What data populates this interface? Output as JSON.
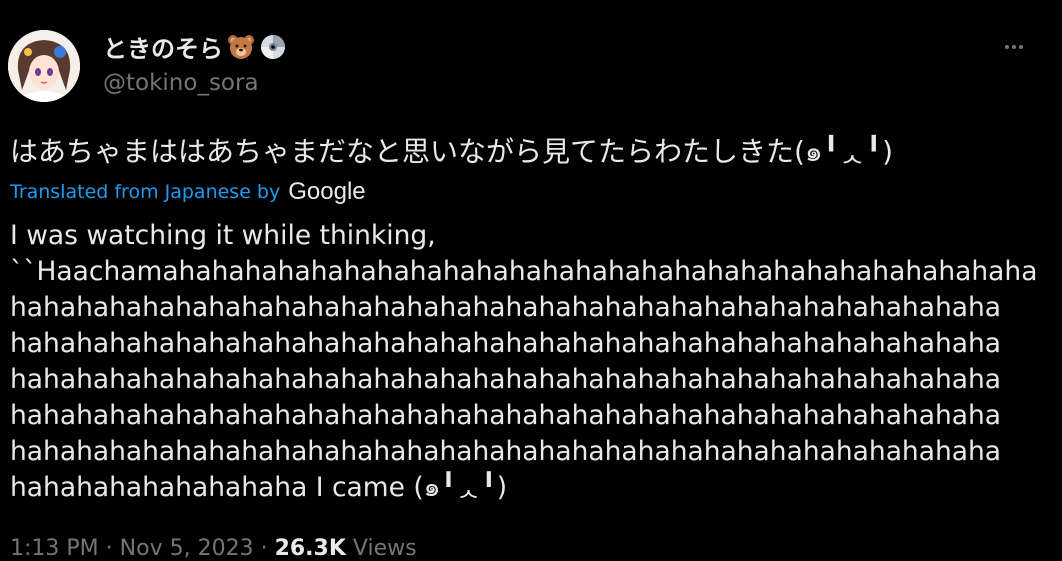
{
  "author": {
    "display_name": "ときのそら",
    "handle": "@tokino_sora",
    "badges": [
      "bear-emoji-icon",
      "cd-disc-icon"
    ]
  },
  "tweet": {
    "original_text": "はあちゃまははあちゃまだなと思いながら見てたらわたしきた(๑╹ᆺ╹)",
    "translated_label": "Translated from Japanese by",
    "translator": "Google",
    "translation_lines": [
      "I was watching it while thinking,",
      "``Haachamahahahahahahahahahahahahahahahahahahahahahahahahahaha",
      "hahahahahahahahahahahahahahahahahahahahahahahahahahahahahaha",
      "hahahahahahahahahahahahahahahahahahahahahahahahahahahahahaha",
      "hahahahahahahahahahahahahahahahahahahahahahahahahahahahahaha",
      "hahahahahahahahahahahahahahahahahahahahahahahahahahahahahaha",
      "hahahahahahahahahahahahahahahahahahahahahahahahahahahahahaha",
      "hahahahahahahahaha I came (๑╹ᆺ╹)"
    ]
  },
  "meta": {
    "time": "1:13 PM",
    "separator": "·",
    "date": "Nov 5, 2023",
    "views_count": "26.3K",
    "views_label": "Views"
  },
  "colors": {
    "background": "#000000",
    "text": "#e7e9ea",
    "secondary": "#71767b",
    "link": "#1d9bf0"
  }
}
